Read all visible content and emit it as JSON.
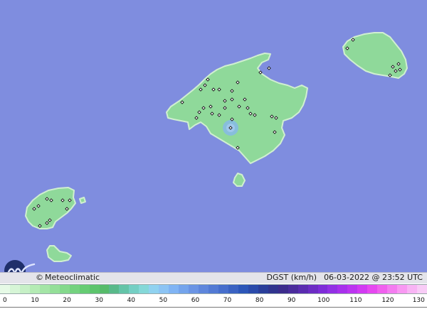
{
  "map": {
    "sea_color": "#7f8ddf",
    "land_color": "#8fd99a",
    "coast_color": "#d0efd0",
    "station_marker_color": "#111111",
    "hotspot_color": "#86b8e6"
  },
  "footer": {
    "copyright_symbol": "©",
    "credit": "Meteoclimatic",
    "variable": "DGST (km/h)",
    "timestamp": "06-03-2022 @ 23:52 UTC"
  },
  "legend": {
    "ticks": [
      "0",
      "10",
      "20",
      "30",
      "40",
      "50",
      "60",
      "70",
      "80",
      "90",
      "100",
      "110",
      "120",
      "130"
    ],
    "colors": [
      "#e6fae6",
      "#d6f5d6",
      "#c6f0c6",
      "#b4ebb4",
      "#a4e5a6",
      "#94df98",
      "#84d98c",
      "#74d27f",
      "#66cc73",
      "#5cc46c",
      "#56bb6a",
      "#58b98a",
      "#64c4a8",
      "#74cfc4",
      "#84d8d8",
      "#90d2f0",
      "#8cc4f4",
      "#80b4f4",
      "#74a4ec",
      "#6a94e4",
      "#5e86dc",
      "#527ad4",
      "#466ecc",
      "#3a62c2",
      "#2c56b8",
      "#2a4aaa",
      "#2a3e9a",
      "#30348e",
      "#3c2c8c",
      "#4a2c9c",
      "#5a2cb0",
      "#6c2cc4",
      "#7e2cd8",
      "#9230e4",
      "#a830ec",
      "#bc34f0",
      "#d23af2",
      "#e648f0",
      "#f060ee",
      "#f47cf0",
      "#f898f2",
      "#f8b4f4",
      "#f8ccf6"
    ]
  }
}
